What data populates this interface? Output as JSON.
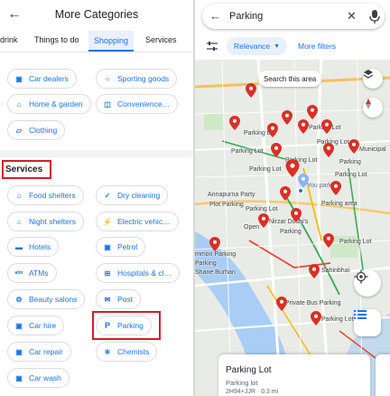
{
  "left_panel": {
    "title": "More Categories",
    "tabs": [
      "drink",
      "Things to do",
      "Shopping",
      "Services"
    ],
    "active_tab": "Shopping",
    "shopping_items": [
      {
        "label": "Car dealers",
        "icon": "car-icon"
      },
      {
        "label": "Sporting goods",
        "icon": "sports-icon"
      },
      {
        "label": "Home & garden",
        "icon": "home-garden-icon"
      },
      {
        "label": "Convenience…",
        "icon": "store-icon"
      },
      {
        "label": "Clothing",
        "icon": "clothing-icon"
      }
    ],
    "services_heading": "Services",
    "services_items": [
      {
        "label": "Food shelters",
        "icon": "shelter-icon"
      },
      {
        "label": "Dry cleaning",
        "icon": "dry-cleaning-icon"
      },
      {
        "label": "Night shelters",
        "icon": "night-shelter-icon"
      },
      {
        "label": "Electric vehic…",
        "icon": "ev-charging-icon"
      },
      {
        "label": "Hotels",
        "icon": "hotel-icon"
      },
      {
        "label": "Petrol",
        "icon": "petrol-icon"
      },
      {
        "label": "ATMs",
        "icon": "atm-icon"
      },
      {
        "label": "Hospitals & cl…",
        "icon": "hospital-icon"
      },
      {
        "label": "Beauty salons",
        "icon": "beauty-icon"
      },
      {
        "label": "Post",
        "icon": "mail-icon"
      },
      {
        "label": "Car hire",
        "icon": "car-hire-icon"
      },
      {
        "label": "Parking",
        "icon": "parking-icon"
      },
      {
        "label": "Car repair",
        "icon": "car-repair-icon"
      },
      {
        "label": "Chemists",
        "icon": "chemist-icon"
      },
      {
        "label": "Car wash",
        "icon": "car-wash-icon"
      }
    ]
  },
  "right_panel": {
    "search_query": "Parking",
    "filter_relevance": "Relevance",
    "filter_more": "More filters",
    "search_this_area": "Search this area",
    "map_labels": [
      "Parking Lot",
      "Parking Lot",
      "Parking Lot",
      "Parking Lot",
      "Parking Lot",
      "Parking Lot",
      "Parking",
      "Municipal",
      "Parking Lot",
      "You park",
      "Parking area",
      "Annapurna Party",
      "Plot Parking",
      "Parking Lot",
      "Nirzar Doshi's",
      "Parking",
      "Open",
      "Parking Lot",
      "mmon Parking",
      "Parking",
      "Shane Burhan",
      "Sahinbhai",
      "Private Bus Parking",
      "Parking Lot"
    ],
    "card": {
      "title": "Parking Lot",
      "subtitle": "Parking lot",
      "meta": "2H94+JJR · 0.3 mi"
    }
  },
  "colors": {
    "accent": "#1a73e8",
    "highlight": "#d01f2a",
    "pin": "#d93025"
  }
}
